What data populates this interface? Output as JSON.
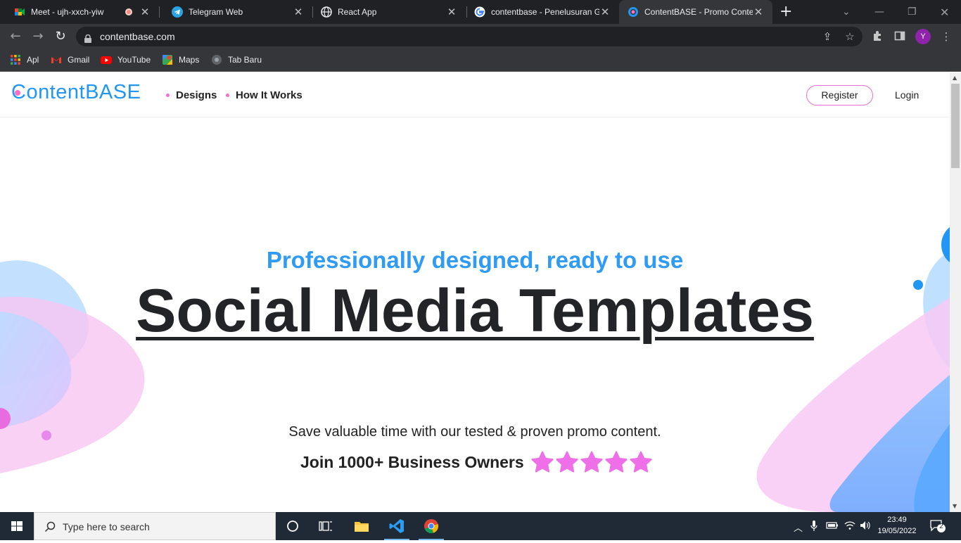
{
  "browser": {
    "tabs": [
      {
        "title": "Meet - ujh-xxch-yiw",
        "recording": true
      },
      {
        "title": "Telegram Web"
      },
      {
        "title": "React App"
      },
      {
        "title": "contentbase - Penelusuran G"
      },
      {
        "title": "ContentBASE - Promo Conte",
        "active": true
      }
    ],
    "url": "contentbase.com",
    "bookmarks": [
      "Apl",
      "Gmail",
      "YouTube",
      "Maps",
      "Tab Baru"
    ],
    "profile_initial": "Y"
  },
  "site": {
    "logo": "ContentBASE",
    "nav": [
      "Designs",
      "How It Works"
    ],
    "register_label": "Register",
    "login_label": "Login"
  },
  "hero": {
    "subtitle": "Professionally designed, ready to use",
    "title": "Social Media Templates",
    "description": "Save valuable time with our tested & proven promo content.",
    "join_text": "Join 1000+ Business Owners",
    "rating_stars": 5,
    "colors": {
      "accent_blue": "#2f9bf5",
      "accent_pink": "#f06fd6",
      "star": "#ee6fe8"
    }
  },
  "taskbar": {
    "search_placeholder": "Type here to search",
    "time": "23:49",
    "date": "19/05/2022",
    "notification_count": "2"
  }
}
